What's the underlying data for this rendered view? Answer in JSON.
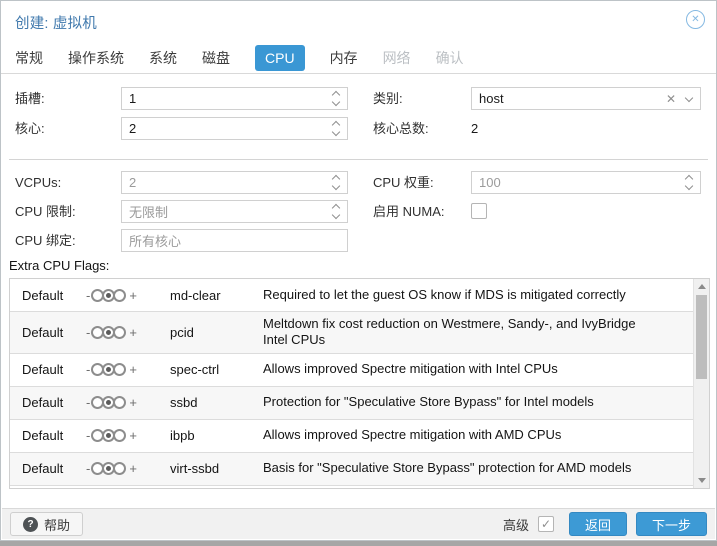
{
  "dialog": {
    "title": "创建: 虚拟机"
  },
  "icons": {
    "close": "✕",
    "clear": "✕",
    "check": "✓",
    "help": "?"
  },
  "tabs": [
    {
      "label": "常规",
      "state": "normal"
    },
    {
      "label": "操作系统",
      "state": "normal"
    },
    {
      "label": "系统",
      "state": "normal"
    },
    {
      "label": "磁盘",
      "state": "normal"
    },
    {
      "label": "CPU",
      "state": "active"
    },
    {
      "label": "内存",
      "state": "normal"
    },
    {
      "label": "网络",
      "state": "disabled"
    },
    {
      "label": "确认",
      "state": "disabled"
    }
  ],
  "form": {
    "sockets": {
      "label": "插槽:",
      "value": "1"
    },
    "type": {
      "label": "类别:",
      "value": "host"
    },
    "cores": {
      "label": "核心:",
      "value": "2"
    },
    "total_cores": {
      "label": "核心总数:",
      "value": "2"
    },
    "vcpus": {
      "label": "VCPUs:",
      "placeholder": "2"
    },
    "cpu_weight": {
      "label": "CPU 权重:",
      "placeholder": "100"
    },
    "cpu_limit": {
      "label": "CPU 限制:",
      "placeholder": "无限制"
    },
    "enable_numa": {
      "label": "启用 NUMA:",
      "checked": false
    },
    "cpu_affinity": {
      "label": "CPU 绑定:",
      "placeholder": "所有核心"
    }
  },
  "flags_section": {
    "title": "Extra CPU Flags:",
    "slider": {
      "minus": "-",
      "plus": "+"
    },
    "rows": [
      {
        "state": "Default",
        "flag": "md-clear",
        "description": "Required to let the guest OS know if MDS is mitigated correctly"
      },
      {
        "state": "Default",
        "flag": "pcid",
        "description": "Meltdown fix cost reduction on Westmere, Sandy-, and IvyBridge Intel CPUs"
      },
      {
        "state": "Default",
        "flag": "spec-ctrl",
        "description": "Allows improved Spectre mitigation with Intel CPUs"
      },
      {
        "state": "Default",
        "flag": "ssbd",
        "description": "Protection for \"Speculative Store Bypass\" for Intel models"
      },
      {
        "state": "Default",
        "flag": "ibpb",
        "description": "Allows improved Spectre mitigation with AMD CPUs"
      },
      {
        "state": "Default",
        "flag": "virt-ssbd",
        "description": "Basis for \"Speculative Store Bypass\" protection for AMD models"
      }
    ]
  },
  "footer": {
    "help_label": "帮助",
    "advanced_label": "高级",
    "advanced_checked": true,
    "back_label": "返回",
    "next_label": "下一步"
  },
  "colors": {
    "accent": "#3a97d4",
    "title_text": "#4079ad",
    "disabled_text": "#bcc0c4"
  }
}
